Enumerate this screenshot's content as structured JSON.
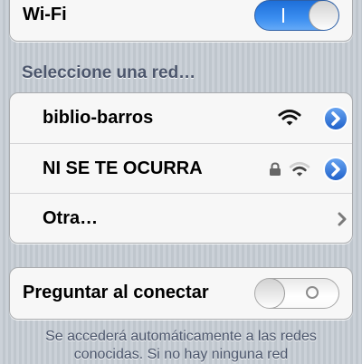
{
  "wifi": {
    "label": "Wi-Fi",
    "enabled": true
  },
  "networks_section": {
    "title": "Seleccione una red…",
    "items": [
      {
        "name": "biblio-barros",
        "secured": false,
        "icons": [
          "wifi-signal-icon",
          "detail-disclosure-icon"
        ]
      },
      {
        "name": "NI SE TE OCURRA",
        "secured": true,
        "icons": [
          "lock-icon",
          "wifi-signal-icon",
          "detail-disclosure-icon"
        ]
      },
      {
        "name": "Otra…",
        "icons": [
          "chevron-right-icon"
        ]
      }
    ]
  },
  "ask_to_join": {
    "label": "Preguntar al conectar",
    "enabled": false
  },
  "footer": {
    "line1": "Se accederá automáticamente a las redes",
    "line2": "conocidas. Si no hay ninguna red"
  },
  "colors": {
    "switch_on": "#2f80ea",
    "disclosure_blue": "#2a6fd6",
    "section_text": "#4c566c"
  }
}
